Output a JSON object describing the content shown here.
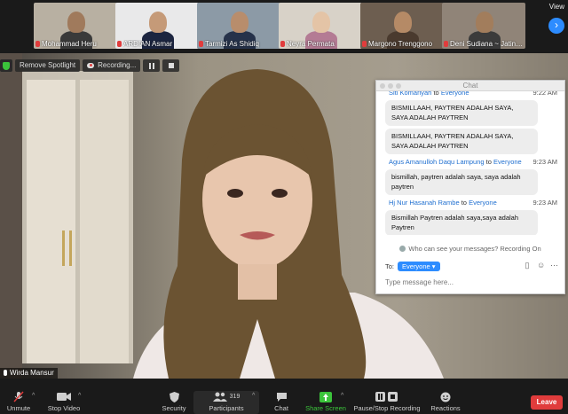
{
  "thumbnails": [
    {
      "name": "Mohammad Heru",
      "bg": "#b8b0a2",
      "skin": "#a07a5c",
      "shirt": "#3a3a3a"
    },
    {
      "name": "ARDIAN Asmar",
      "bg": "#e9e9ea",
      "skin": "#c59a78",
      "shirt": "#1c2540"
    },
    {
      "name": "Tarmizi As Shidiq",
      "bg": "#8c9aa6",
      "skin": "#b88d6c",
      "shirt": "#26324a"
    },
    {
      "name": "Neyra Permata",
      "bg": "#d8d2c8",
      "skin": "#e4c4a6",
      "shirt": "#b47b94"
    },
    {
      "name": "Margono Trenggono",
      "bg": "#6d5e50",
      "skin": "#b58a66",
      "shirt": "#4a3a2e"
    },
    {
      "name": "Deni Sudiana ~ Jatina...",
      "bg": "#908478",
      "skin": "#a27d5c",
      "shirt": "#3b3b3b"
    }
  ],
  "top_bar": {
    "view_label": "View",
    "next_icon": "chevron-right-icon"
  },
  "spotlight": {
    "remove_label": "Remove Spotlight",
    "recording_label": "Recording..."
  },
  "speaker": {
    "name": "Wirda Mansur"
  },
  "chat": {
    "title": "Chat",
    "messages": [
      {
        "sender": "Siti Komariyah",
        "to": "Everyone",
        "time": "9:22 AM",
        "bubbles": [
          "BISMILLAAH, PAYTREN ADALAH SAYA, SAYA ADALAH PAYTREN",
          "BISMILLAAH, PAYTREN ADALAH SAYA, SAYA ADALAH PAYTREN"
        ]
      },
      {
        "sender": "Agus Amanulloh Daqu Lampung",
        "to": "Everyone",
        "time": "9:23 AM",
        "bubbles": [
          "bismillah, paytren adalah saya, saya adalah paytren"
        ]
      },
      {
        "sender": "Hj Nur Hasanah Rambe",
        "to": "Everyone",
        "time": "9:23 AM",
        "bubbles": [
          "Bismillah Paytren adalah saya,saya adalah Paytren"
        ]
      }
    ],
    "to_word": "to",
    "privacy_text": "Who can see your messages? Recording On",
    "to_label": "To:",
    "recipient": "Everyone",
    "input_placeholder": "Type message here..."
  },
  "toolbar": {
    "unmute": "Unmute",
    "stop_video": "Stop Video",
    "security": "Security",
    "participants": "Participants",
    "participants_count": "319",
    "chat": "Chat",
    "share_screen": "Share Screen",
    "pause_recording": "Pause/Stop Recording",
    "reactions": "Reactions",
    "leave": "Leave"
  },
  "colors": {
    "accent": "#2d8cff",
    "leave": "#e03c3c",
    "share": "#3bc43b"
  }
}
